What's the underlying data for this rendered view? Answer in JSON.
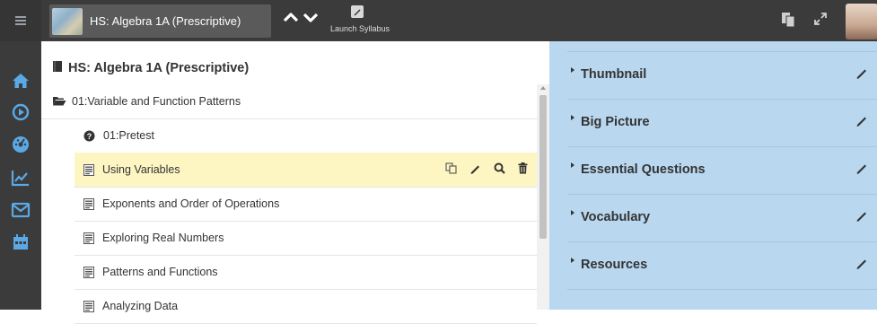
{
  "app": {
    "course_tab_title": "HS: Algebra 1A (Prescriptive)",
    "launch_label": "Launch Syllabus"
  },
  "icons": {
    "hamburger": "hamburger-icon",
    "chevron_up": "chevron-up-icon",
    "chevron_down": "chevron-down-icon",
    "pencil": "pencil-icon",
    "copy": "copy-icon",
    "expand": "expand-icon",
    "home": "home-icon",
    "play": "play-icon",
    "gauge": "gauge-icon",
    "chart": "chart-icon",
    "mail": "mail-icon",
    "calendar": "calendar-icon"
  },
  "colors": {
    "topbar": "#3b3b3b",
    "selected_row": "#fdf6c3",
    "right_pane": "#b9d8f0",
    "rail_icon": "#5aa9e6"
  },
  "course": {
    "header": "HS: Algebra 1A (Prescriptive)",
    "unit": "01:Variable and Function Patterns",
    "lessons": [
      {
        "label": "01:Pretest",
        "icon": "question-circle-icon"
      },
      {
        "label": "Using Variables",
        "icon": "lesson-doc-icon",
        "selected": true
      },
      {
        "label": "Exponents and Order of Operations",
        "icon": "lesson-doc-icon"
      },
      {
        "label": "Exploring Real Numbers",
        "icon": "lesson-doc-icon"
      },
      {
        "label": "Patterns and Functions",
        "icon": "lesson-doc-icon"
      },
      {
        "label": "Analyzing Data",
        "icon": "lesson-doc-icon"
      }
    ]
  },
  "details": {
    "sections": [
      "Thumbnail",
      "Big Picture",
      "Essential Questions",
      "Vocabulary",
      "Resources"
    ]
  }
}
